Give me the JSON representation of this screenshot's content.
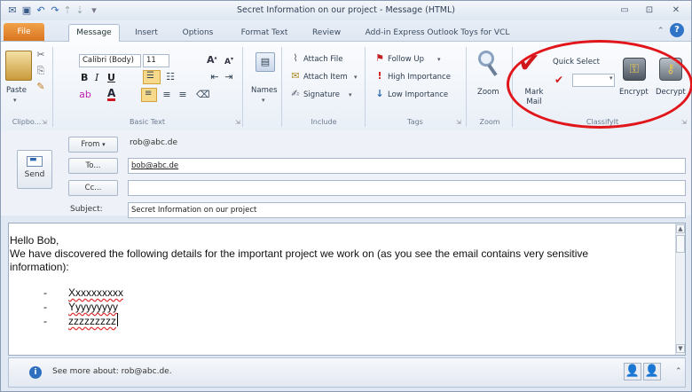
{
  "window": {
    "title": "Secret Information on our project  -  Message (HTML)",
    "controls": [
      "▭",
      "⊡",
      "✕"
    ]
  },
  "tabs": [
    "File",
    "Message",
    "Insert",
    "Options",
    "Format Text",
    "Review",
    "Add-in Express Outlook Toys for VCL"
  ],
  "ribbon": {
    "clipboard": {
      "paste": "Paste",
      "group": "Clipbo..."
    },
    "basic_text": {
      "font": "Calibri (Body)",
      "size": "11",
      "group": "Basic Text"
    },
    "names": {
      "label": "Names"
    },
    "include": {
      "attach_file": "Attach File",
      "attach_item": "Attach Item",
      "signature": "Signature",
      "group": "Include"
    },
    "tags": {
      "follow_up": "Follow Up",
      "high": "High Importance",
      "low": "Low Importance",
      "group": "Tags"
    },
    "zoom": {
      "label": "Zoom",
      "group": "Zoom"
    },
    "classifyit": {
      "mark_mail": "Mark Mail",
      "quick_select": "Quick Select",
      "encrypt": "Encrypt",
      "decrypt": "Decrypt",
      "group": "ClassifyIt"
    }
  },
  "compose": {
    "from_label": "From",
    "from_value": "rob@abc.de",
    "send_label": "Send",
    "to_label": "To...",
    "to_value": "bob@abc.de",
    "cc_label": "Cc...",
    "cc_value": "",
    "subject_label": "Subject:",
    "subject_value": "Secret Information on our project"
  },
  "body": {
    "greeting": "Hello Bob,",
    "line1": "We have discovered the following details for the important project we work on (as you see the email contains very sensitive",
    "line2": "information):",
    "bullets": [
      "Xxxxxxxxxx",
      "Yyyyyyyyy",
      "zzzzzzzzz"
    ]
  },
  "people_pane": {
    "text": "See more about: rob@abc.de."
  }
}
